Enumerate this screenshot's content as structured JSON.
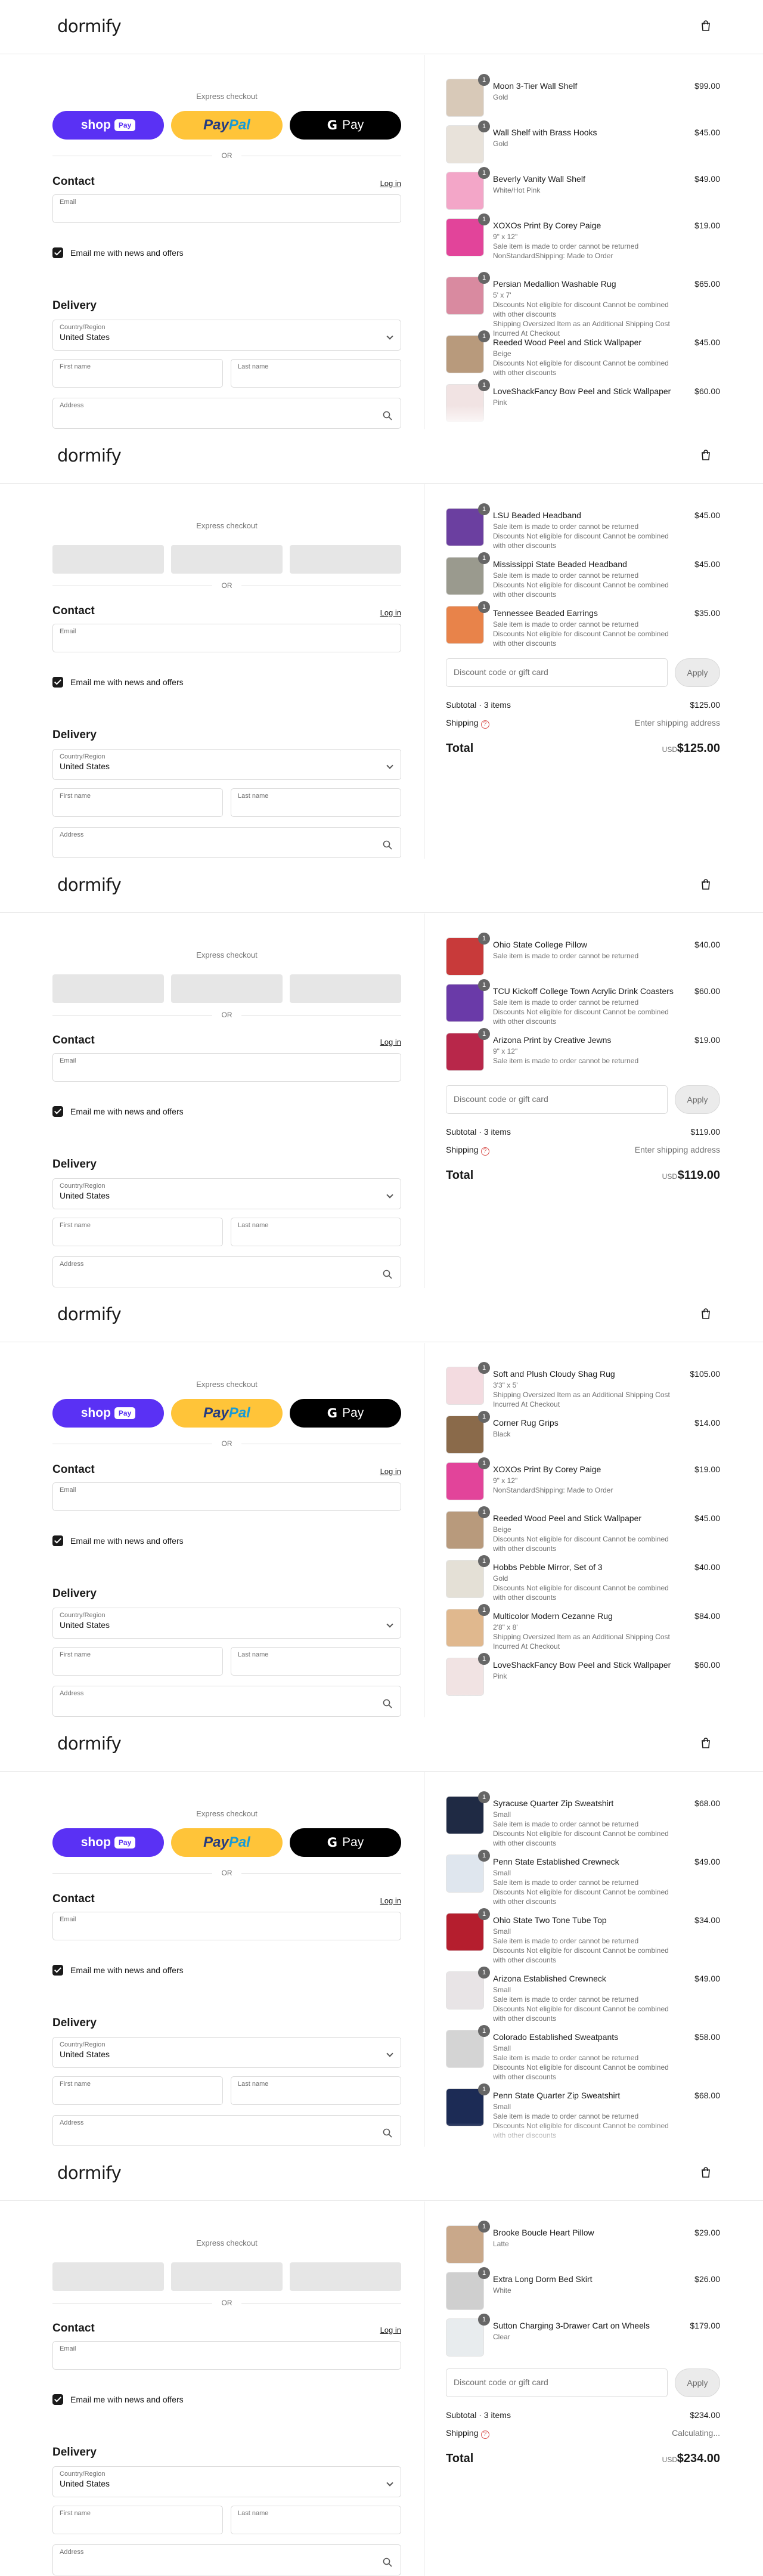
{
  "brand": "dormify",
  "express_checkout": "Express checkout",
  "or": "OR",
  "pay_buttons": {
    "shop": "shop",
    "shop_badge": "Pay",
    "paypal_a": "Pay",
    "paypal_b": "Pal",
    "gpay_g": "G",
    "gpay": "Pay"
  },
  "contact_title": "Contact",
  "login": "Log in",
  "email_placeholder": "Email",
  "newsletter": "Email me with news and offers",
  "delivery_title": "Delivery",
  "country_label": "Country/Region",
  "country_value": "United States",
  "first_name": "First name",
  "last_name": "Last name",
  "address": "Address",
  "discount_placeholder": "Discount code or gift card",
  "apply": "Apply",
  "shipping_label": "Shipping",
  "total_label": "Total",
  "currency": "USD",
  "colors": {
    "shop_pay": "#5a31f4",
    "paypal": "#ffc439",
    "gpay": "#000000"
  },
  "snapshots": [
    {
      "express_loaded": true,
      "items": [
        {
          "qty": "1",
          "name": "Moon 3-Tier Wall Shelf",
          "meta": [
            "Gold"
          ],
          "price": "$99.00",
          "color": "#d8c9b8"
        },
        {
          "qty": "1",
          "name": "Wall Shelf with Brass Hooks",
          "meta": [
            "Gold"
          ],
          "price": "$45.00",
          "color": "#e8e2da"
        },
        {
          "qty": "1",
          "name": "Beverly Vanity Wall Shelf",
          "meta": [
            "White/Hot Pink"
          ],
          "price": "$49.00",
          "color": "#f3a6c8"
        },
        {
          "qty": "1",
          "name": "XOXOs Print By Corey Paige",
          "meta": [
            "9\" x 12\"",
            "Sale item is made to order cannot be returned",
            "NonStandardShipping: Made to Order"
          ],
          "price": "$19.00",
          "color": "#e2449a"
        },
        {
          "qty": "1",
          "name": "Persian Medallion Washable Rug",
          "meta": [
            "5' x 7'",
            "Discounts Not eligible for discount Cannot be combined with other discounts",
            "Shipping Oversized Item as an Additional Shipping Cost Incurred At Checkout"
          ],
          "price": "$65.00",
          "color": "#d98aa0"
        },
        {
          "qty": "1",
          "name": "Reeded Wood Peel and Stick Wallpaper",
          "meta": [
            "Beige",
            "Discounts Not eligible for discount Cannot be combined with other discounts"
          ],
          "price": "$45.00",
          "color": "#b89a7c"
        },
        {
          "qty": "1",
          "name": "LoveShackFancy Bow Peel and Stick Wallpaper",
          "meta": [
            "Pink"
          ],
          "price": "$60.00",
          "color": "#f1e3e3"
        }
      ]
    },
    {
      "express_loaded": false,
      "items": [
        {
          "qty": "1",
          "name": "LSU Beaded Headband",
          "meta": [
            "Sale item is made to order cannot be returned",
            "Discounts Not eligible for discount Cannot be combined with other discounts"
          ],
          "price": "$45.00",
          "color": "#6b3fa0"
        },
        {
          "qty": "1",
          "name": "Mississippi State Beaded Headband",
          "meta": [
            "Sale item is made to order cannot be returned",
            "Discounts Not eligible for discount Cannot be combined with other discounts"
          ],
          "price": "$45.00",
          "color": "#9a9a8e"
        },
        {
          "qty": "1",
          "name": "Tennessee Beaded Earrings",
          "meta": [
            "Sale item is made to order cannot be returned",
            "Discounts Not eligible for discount Cannot be combined with other discounts"
          ],
          "price": "$35.00",
          "color": "#e8834a"
        }
      ],
      "subtotal_label": "Subtotal · 3 items",
      "subtotal": "$125.00",
      "shipping_value": "Enter shipping address",
      "total": "$125.00"
    },
    {
      "express_loaded": false,
      "items": [
        {
          "qty": "1",
          "name": "Ohio State College Pillow",
          "meta": [
            "Sale item is made to order cannot be returned"
          ],
          "price": "$40.00",
          "color": "#c83a3a"
        },
        {
          "qty": "1",
          "name": "TCU Kickoff College Town Acrylic Drink Coasters",
          "meta": [
            "Sale item is made to order cannot be returned",
            "Discounts Not eligible for discount Cannot be combined with other discounts"
          ],
          "price": "$60.00",
          "color": "#6a3aa8"
        },
        {
          "qty": "1",
          "name": "Arizona Print by Creative Jewns",
          "meta": [
            "9\" x 12\"",
            "Sale item is made to order cannot be returned"
          ],
          "price": "$19.00",
          "color": "#b8274a"
        }
      ],
      "subtotal_label": "Subtotal · 3 items",
      "subtotal": "$119.00",
      "shipping_value": "Enter shipping address",
      "total": "$119.00"
    },
    {
      "express_loaded": true,
      "items": [
        {
          "qty": "1",
          "name": "Soft and Plush Cloudy Shag Rug",
          "meta": [
            "3'3\" x 5'",
            "Shipping Oversized Item as an Additional Shipping Cost Incurred At Checkout"
          ],
          "price": "$105.00",
          "color": "#f3dbe0"
        },
        {
          "qty": "1",
          "name": "Corner Rug Grips",
          "meta": [
            "Black"
          ],
          "price": "$14.00",
          "color": "#8a6a4a"
        },
        {
          "qty": "1",
          "name": "XOXOs Print By Corey Paige",
          "meta": [
            "9\" x 12\"",
            "NonStandardShipping: Made to Order"
          ],
          "price": "$19.00",
          "color": "#e2449a"
        },
        {
          "qty": "1",
          "name": "Reeded Wood Peel and Stick Wallpaper",
          "meta": [
            "Beige",
            "Discounts Not eligible for discount Cannot be combined with other discounts"
          ],
          "price": "$45.00",
          "color": "#b89a7c"
        },
        {
          "qty": "1",
          "name": "Hobbs Pebble Mirror, Set of 3",
          "meta": [
            "Gold",
            "Discounts Not eligible for discount Cannot be combined with other discounts"
          ],
          "price": "$40.00",
          "color": "#e4e0d6"
        },
        {
          "qty": "1",
          "name": "Multicolor Modern Cezanne Rug",
          "meta": [
            "2'8\" x 8'",
            "Shipping Oversized Item as an Additional Shipping Cost Incurred At Checkout"
          ],
          "price": "$84.00",
          "color": "#e0b88e"
        },
        {
          "qty": "1",
          "name": "LoveShackFancy Bow Peel and Stick Wallpaper",
          "meta": [
            "Pink"
          ],
          "price": "$60.00",
          "color": "#f1e3e3"
        }
      ]
    },
    {
      "express_loaded": true,
      "items": [
        {
          "qty": "1",
          "name": "Syracuse Quarter Zip Sweatshirt",
          "meta": [
            "Small",
            "Sale item is made to order cannot be returned",
            "Discounts Not eligible for discount Cannot be combined with other discounts"
          ],
          "price": "$68.00",
          "color": "#1f2a44"
        },
        {
          "qty": "1",
          "name": "Penn State Established Crewneck",
          "meta": [
            "Small",
            "Sale item is made to order cannot be returned",
            "Discounts Not eligible for discount Cannot be combined with other discounts"
          ],
          "price": "$49.00",
          "color": "#dfe6ee"
        },
        {
          "qty": "1",
          "name": "Ohio State Two Tone Tube Top",
          "meta": [
            "Small",
            "Sale item is made to order cannot be returned",
            "Discounts Not eligible for discount Cannot be combined with other discounts"
          ],
          "price": "$34.00",
          "color": "#b51e2e"
        },
        {
          "qty": "1",
          "name": "Arizona Established Crewneck",
          "meta": [
            "Small",
            "Sale item is made to order cannot be returned",
            "Discounts Not eligible for discount Cannot be combined with other discounts"
          ],
          "price": "$49.00",
          "color": "#e8e4e6"
        },
        {
          "qty": "1",
          "name": "Colorado Established Sweatpants",
          "meta": [
            "Small",
            "Sale item is made to order cannot be returned",
            "Discounts Not eligible for discount Cannot be combined with other discounts"
          ],
          "price": "$58.00",
          "color": "#d4d4d4"
        },
        {
          "qty": "1",
          "name": "Penn State Quarter Zip Sweatshirt",
          "meta": [
            "Small",
            "Sale item is made to order cannot be returned",
            "Discounts Not eligible for discount Cannot be combined with other discounts"
          ],
          "price": "$68.00",
          "color": "#1c2b55"
        }
      ]
    },
    {
      "express_loaded": false,
      "items": [
        {
          "qty": "1",
          "name": "Brooke Boucle Heart Pillow",
          "meta": [
            "Latte"
          ],
          "price": "$29.00",
          "color": "#c9a88a"
        },
        {
          "qty": "1",
          "name": "Extra Long Dorm Bed Skirt",
          "meta": [
            "White"
          ],
          "price": "$26.00",
          "color": "#cfcfcf"
        },
        {
          "qty": "1",
          "name": "Sutton Charging 3-Drawer Cart on Wheels",
          "meta": [
            "Clear"
          ],
          "price": "$179.00",
          "color": "#e8ecee"
        }
      ],
      "subtotal_label": "Subtotal · 3 items",
      "subtotal": "$234.00",
      "shipping_value": "Calculating...",
      "total": "$234.00"
    }
  ]
}
